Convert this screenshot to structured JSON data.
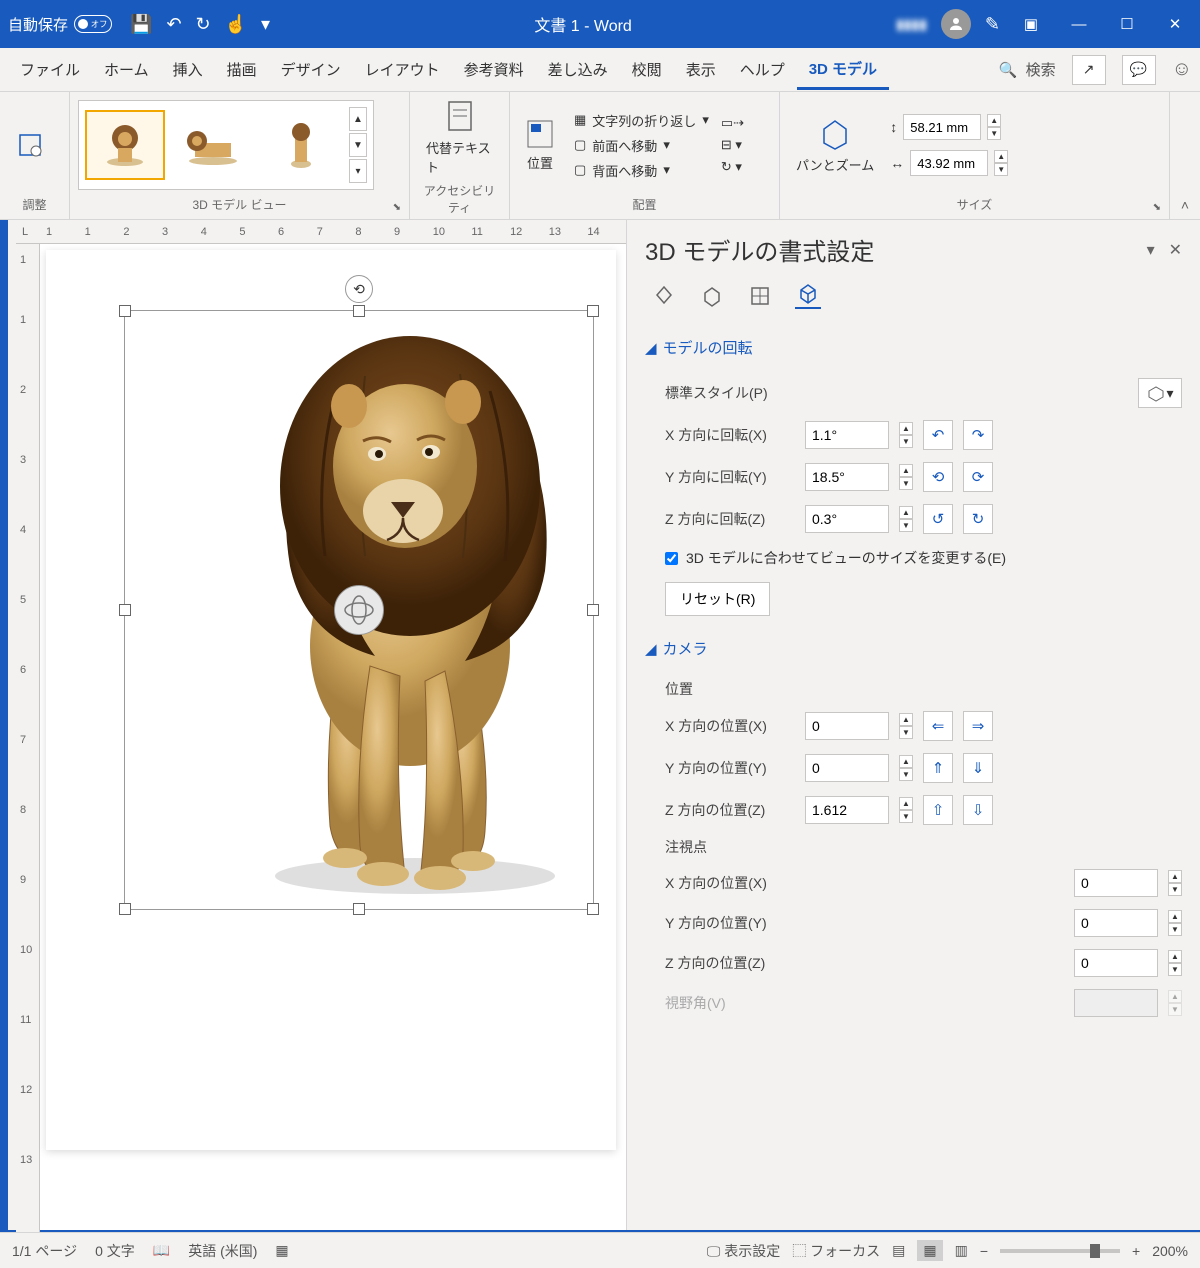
{
  "titlebar": {
    "autosave_label": "自動保存",
    "autosave_state": "オフ",
    "doc_title": "文書 1 - Word"
  },
  "tabs": {
    "file": "ファイル",
    "home": "ホーム",
    "insert": "挿入",
    "draw": "描画",
    "design": "デザイン",
    "layout": "レイアウト",
    "references": "参考資料",
    "mailings": "差し込み",
    "review": "校閲",
    "view": "表示",
    "help": "ヘルプ",
    "model3d": "3D モデル",
    "search": "検索"
  },
  "ribbon": {
    "adjust_label": "調整",
    "views_label": "3D モデル ビュー",
    "alt_text": "代替テキスト",
    "accessibility_label": "アクセシビリティ",
    "position": "位置",
    "wrap_text": "文字列の折り返し",
    "bring_forward": "前面へ移動",
    "send_backward": "背面へ移動",
    "arrange_label": "配置",
    "pan_zoom": "パンとズーム",
    "size_label": "サイズ",
    "height_value": "58.21 mm",
    "width_value": "43.92 mm"
  },
  "pane": {
    "title": "3D モデルの書式設定",
    "section_rotation": "モデルの回転",
    "preset_label": "標準スタイル(P)",
    "x_rotation_label": "X 方向に回転(X)",
    "x_rotation_value": "1.1°",
    "y_rotation_label": "Y 方向に回転(Y)",
    "y_rotation_value": "18.5°",
    "z_rotation_label": "Z 方向に回転(Z)",
    "z_rotation_value": "0.3°",
    "fit_view_label": "3D モデルに合わせてビューのサイズを変更する(E)",
    "reset_label": "リセット(R)",
    "section_camera": "カメラ",
    "position_label": "位置",
    "x_pos_label": "X 方向の位置(X)",
    "x_pos_value": "0",
    "y_pos_label": "Y 方向の位置(Y)",
    "y_pos_value": "0",
    "z_pos_label": "Z 方向の位置(Z)",
    "z_pos_value": "1.612",
    "lookat_label": "注視点",
    "lookat_x_label": "X 方向の位置(X)",
    "lookat_x_value": "0",
    "lookat_y_label": "Y 方向の位置(Y)",
    "lookat_y_value": "0",
    "lookat_z_label": "Z 方向の位置(Z)",
    "lookat_z_value": "0",
    "fov_label": "視野角(V)"
  },
  "statusbar": {
    "page": "1/1 ページ",
    "words": "0 文字",
    "language": "英語 (米国)",
    "display_settings": "表示設定",
    "focus": "フォーカス",
    "zoom": "200%"
  },
  "ruler": {
    "h": [
      "1",
      "1",
      "2",
      "3",
      "4",
      "5",
      "6",
      "7",
      "8",
      "9",
      "10",
      "11",
      "12",
      "13",
      "14"
    ],
    "v": [
      "1",
      "1",
      "2",
      "3",
      "4",
      "5",
      "6",
      "7",
      "8",
      "9",
      "10",
      "11",
      "12",
      "13"
    ]
  }
}
